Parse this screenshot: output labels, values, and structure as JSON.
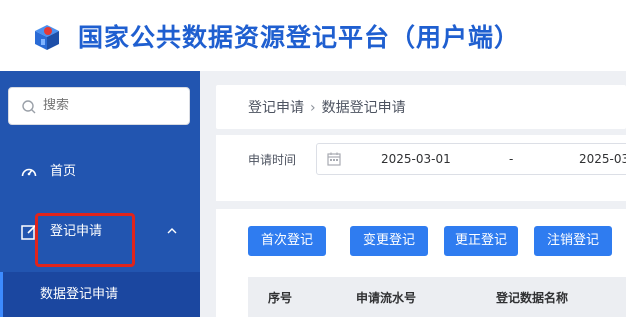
{
  "app": {
    "title": "国家公共数据资源登记平台（用户端）"
  },
  "sidebar": {
    "search_placeholder": "搜索",
    "items": [
      {
        "label": "首页",
        "icon": "dashboard-icon"
      },
      {
        "label": "登记申请",
        "icon": "edit-icon"
      }
    ],
    "subitems": [
      {
        "label": "数据登记申请"
      }
    ]
  },
  "breadcrumb": {
    "items": [
      "登记申请",
      "数据登记申请"
    ]
  },
  "filter": {
    "label": "申请时间",
    "date_start": "2025-03-01",
    "date_sep": "-",
    "date_end": "2025-03-"
  },
  "toolbar": {
    "buttons": [
      "首次登记",
      "变更登记",
      "更正登记",
      "注销登记"
    ]
  },
  "table": {
    "columns": [
      "序号",
      "申请流水号",
      "登记数据名称"
    ]
  },
  "colors": {
    "brand": "#1f5fd0",
    "sidebar": "#2255b0",
    "button": "#2f7cf0",
    "highlight": "#e0241b"
  }
}
